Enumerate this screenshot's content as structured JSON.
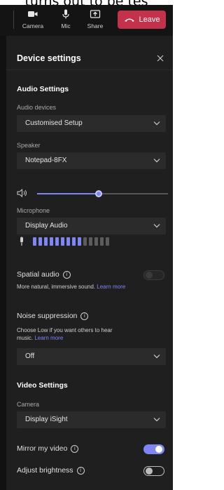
{
  "caption": "turns out to be tes",
  "toolbar": {
    "camera_label": "Camera",
    "mic_label": "Mic",
    "share_label": "Share",
    "leave_label": "Leave"
  },
  "panel": {
    "title": "Device settings",
    "audio": {
      "section_title": "Audio Settings",
      "devices_label": "Audio devices",
      "devices_value": "Customised Setup",
      "speaker_label": "Speaker",
      "speaker_value": "Notepad-8FX",
      "speaker_volume_fraction": 0.47,
      "microphone_label": "Microphone",
      "microphone_value": "Display Audio",
      "mic_level_bars_total": 14,
      "mic_level_bars_active": 9
    },
    "spatial": {
      "label": "Spatial audio",
      "desc": "More natural, immersive sound.",
      "link": "Learn more",
      "enabled": false
    },
    "noise": {
      "label": "Noise suppression",
      "desc_line1": "Choose Low if you want others to hear",
      "desc_line2": "music.",
      "link": "Learn more",
      "value": "Off"
    },
    "video": {
      "section_title": "Video Settings",
      "camera_label": "Camera",
      "camera_value": "Display iSight",
      "mirror_label": "Mirror my video",
      "mirror_on": true,
      "brightness_label": "Adjust brightness",
      "brightness_on": false
    }
  },
  "colors": {
    "accent": "#7f85f5",
    "leave": "#c4314b",
    "panel_bg": "#1f1f1f"
  }
}
